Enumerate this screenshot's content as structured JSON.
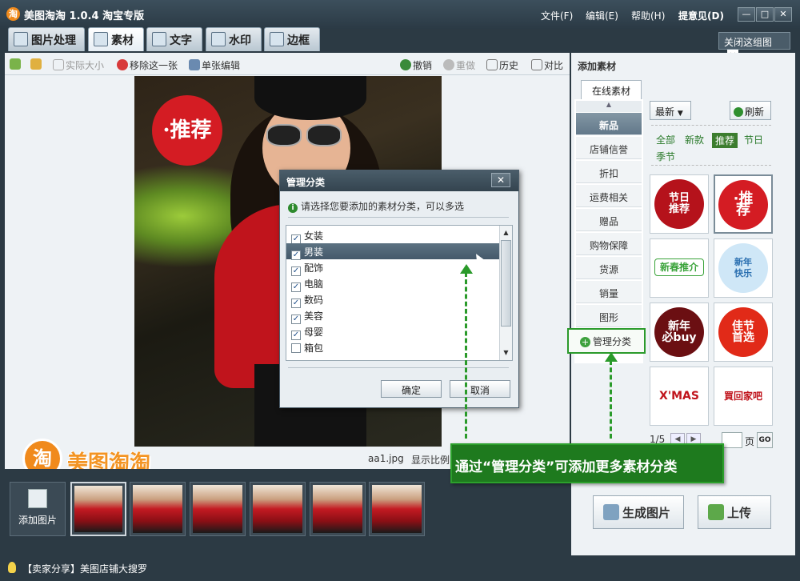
{
  "app": {
    "logo_char": "淘",
    "title": "美图淘淘 1.0.4 淘宝专版"
  },
  "menu": [
    "文件(F)",
    "编辑(E)",
    "帮助(H)",
    "提意见(D)"
  ],
  "window_buttons": [
    "—",
    "□",
    "✕"
  ],
  "tabs": [
    {
      "label": "图片处理",
      "icon": "palette-icon"
    },
    {
      "label": "素材",
      "icon": "sticker-icon"
    },
    {
      "label": "文字",
      "icon": "text-icon"
    },
    {
      "label": "水印",
      "icon": "watermark-icon"
    },
    {
      "label": "边框",
      "icon": "frame-icon"
    }
  ],
  "close_image": "关闭这组图",
  "toolbar": {
    "actual_size": "实际大小",
    "remove_one": "移除这一张",
    "single_edit": "单张编辑",
    "undo": "撤销",
    "redo": "重做",
    "history": "历史",
    "compare": "对比"
  },
  "photo": {
    "badge_text": "·推荐"
  },
  "status": {
    "file": "aa1.jpg",
    "show_ratio": "显示比例"
  },
  "brand": {
    "logo_char": "淘",
    "name": "美图淘淘"
  },
  "filmstrip": {
    "add_label": "添加图片",
    "thumb_count": 6
  },
  "right_panel": {
    "title": "添加素材",
    "online_tab": "在线素材",
    "categories": [
      "新品",
      "店铺信誉",
      "折扣",
      "运费相关",
      "赠品",
      "购物保障",
      "货源",
      "销量",
      "图形"
    ],
    "manage": "管理分类",
    "sort": "最新",
    "refresh": "刷新",
    "filters": [
      "全部",
      "新款",
      "推荐",
      "节日"
    ],
    "season": "季节",
    "stickers": [
      "节日\n推荐",
      "·推\n荐",
      "新春推介",
      "新年\n快乐",
      "新年\n必buy",
      "佳节\n首选",
      "X'MAS",
      "買回家吧"
    ],
    "pager": "1/5",
    "page_label": "页",
    "go": "GO"
  },
  "buttons": {
    "generate": "生成图片",
    "upload": "上传"
  },
  "tip": "【卖家分享】美图店铺大搜罗",
  "dialog": {
    "title": "管理分类",
    "info": "请选择您要添加的素材分类，可以多选",
    "items": [
      {
        "label": "女装",
        "checked": true
      },
      {
        "label": "男装",
        "checked": true
      },
      {
        "label": "配饰",
        "checked": true
      },
      {
        "label": "电脑",
        "checked": true
      },
      {
        "label": "数码",
        "checked": true
      },
      {
        "label": "美容",
        "checked": true
      },
      {
        "label": "母婴",
        "checked": true
      },
      {
        "label": "箱包",
        "checked": false
      }
    ],
    "ok": "确定",
    "cancel": "取消"
  },
  "callout": "通过“管理分类”可添加更多素材分类",
  "colors": {
    "accent_green": "#1e7a1e",
    "brand_orange": "#f08a1c",
    "title_bar": "#2c3a44"
  }
}
